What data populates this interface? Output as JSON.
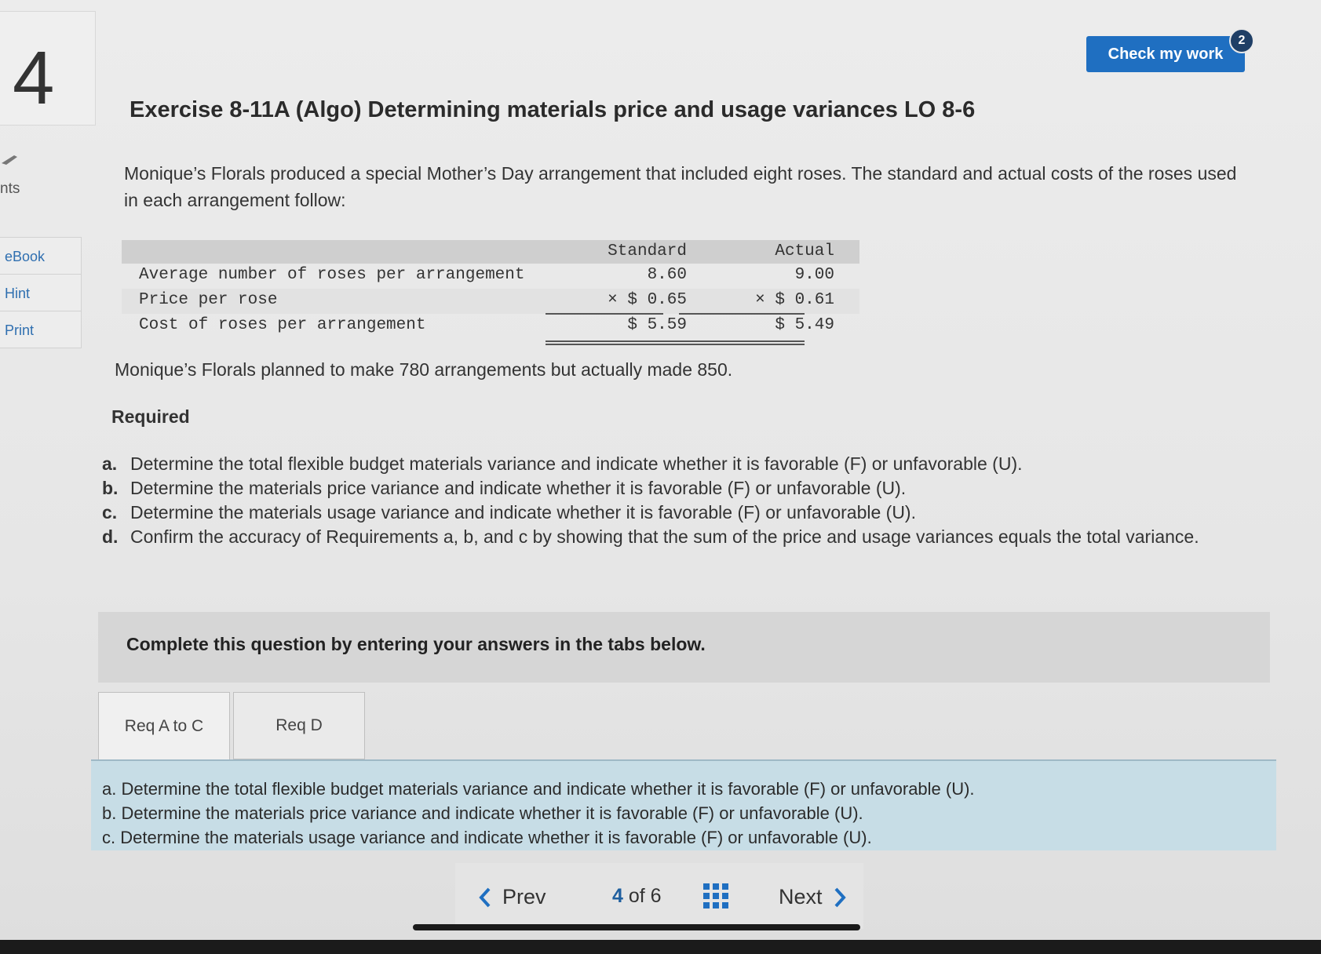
{
  "question": {
    "number": "4",
    "points_label": "nts"
  },
  "side_nav": {
    "ebook": "eBook",
    "hint": "Hint",
    "print": "Print"
  },
  "header": {
    "check_label": "Check my work",
    "check_count": "2"
  },
  "exercise": {
    "title": "Exercise 8-11A (Algo) Determining materials price and usage variances LO 8-6",
    "intro": "Monique’s Florals produced a special Mother’s Day arrangement that included eight roses. The standard and actual costs of the roses used in each arrangement follow:"
  },
  "cost_table": {
    "headers": {
      "standard": "Standard",
      "actual": "Actual"
    },
    "rows": [
      {
        "label": "Average number of roses per arrangement",
        "standard": "8.60",
        "actual": "9.00"
      },
      {
        "label": "Price per rose",
        "standard": "× $ 0.65",
        "actual": "× $ 0.61"
      },
      {
        "label": "Cost of roses per arrangement",
        "standard": "$ 5.59",
        "actual": "$ 5.49"
      }
    ]
  },
  "plan_text": "Monique’s Florals planned to make 780 arrangements but actually made 850.",
  "required_heading": "Required",
  "requirements": [
    {
      "letter": "a.",
      "text": "Determine the total flexible budget materials variance and indicate whether it is favorable (F) or unfavorable (U)."
    },
    {
      "letter": "b.",
      "text": "Determine the materials price variance and indicate whether it is favorable (F) or unfavorable (U)."
    },
    {
      "letter": "c.",
      "text": "Determine the materials usage variance and indicate whether it is favorable (F) or unfavorable (U)."
    },
    {
      "letter": "d.",
      "text": "Confirm the accuracy of Requirements a, b, and c by showing that the sum of the price and usage variances equals the total variance."
    }
  ],
  "complete_text": "Complete this question by entering your answers in the tabs below.",
  "tabs": [
    {
      "label": "Req A to C"
    },
    {
      "label": "Req D"
    }
  ],
  "info_panel": [
    "a. Determine the total flexible budget materials variance and indicate whether it is favorable (F) or unfavorable (U).",
    "b. Determine the materials price variance and indicate whether it is favorable (F) or unfavorable (U).",
    "c. Determine the materials usage variance and indicate whether it is favorable (F) or unfavorable (U)."
  ],
  "pagination": {
    "prev": "Prev",
    "current": "4",
    "of": "of",
    "total": "6",
    "next": "Next"
  },
  "colors": {
    "accent": "#1f6fc1",
    "badge": "#1f3f66",
    "panel": "#c7dde6"
  }
}
